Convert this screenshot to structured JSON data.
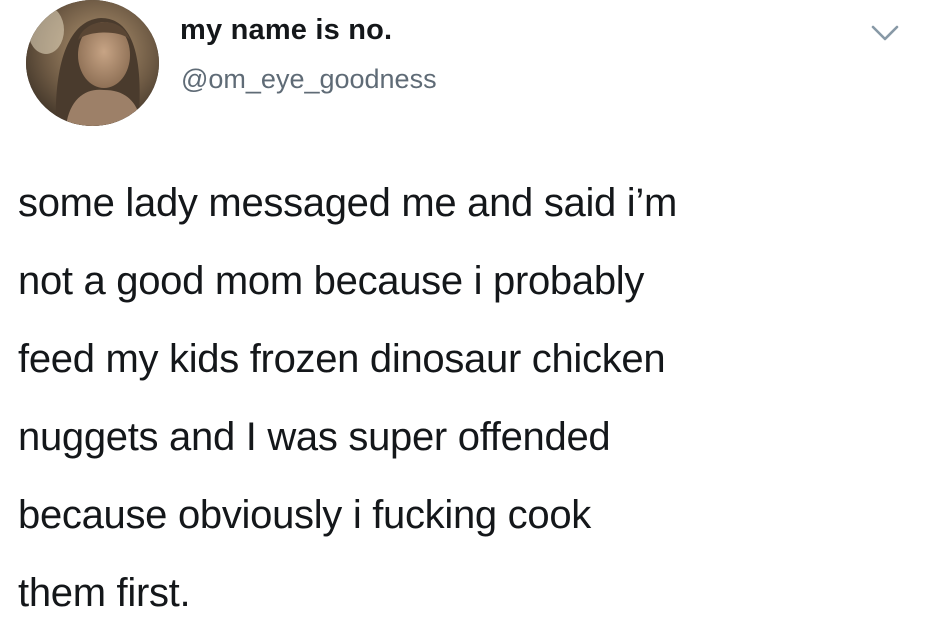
{
  "tweet": {
    "display_name": "my name is no.",
    "handle": "@om_eye_goodness",
    "body_lines": [
      "some lady messaged me and said i’m",
      "not a good mom because i probably",
      "feed my kids frozen dinosaur chicken",
      "nuggets and I was super offended",
      "because obviously i fucking cook",
      "them first."
    ]
  },
  "icons": {
    "avatar": "profile-photo",
    "menu": "chevron-down-icon"
  },
  "colors": {
    "text_primary": "#14171a",
    "text_secondary": "#5f6b76",
    "chevron": "#8899a6",
    "background": "#ffffff"
  }
}
